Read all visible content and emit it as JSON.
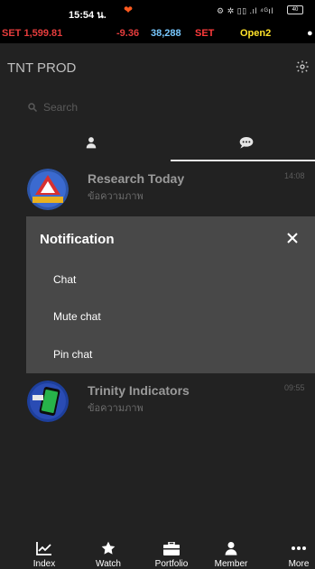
{
  "status": {
    "time": "15:54 น.",
    "battery": "40",
    "icons": "⚙ ✲ ▯▯ .ıl ⁴ᴳıl"
  },
  "ticker": {
    "index": "SET 1,599.81",
    "change": "-9.36",
    "volume": "38,288",
    "market": "SET",
    "status": "Open2",
    "tail": "●"
  },
  "header": {
    "title": "TNT PROD"
  },
  "search": {
    "placeholder": "Search",
    "value": ""
  },
  "chats": [
    {
      "name": "Research Today",
      "preview": "ข้อความภาพ",
      "time": "14:08"
    },
    {
      "name": "Trinity Indicators",
      "preview": "ข้อความภาพ",
      "time": "09:55"
    }
  ],
  "modal": {
    "title": "Notification",
    "options": [
      "Chat",
      "Mute chat",
      "Pin chat"
    ]
  },
  "nav": {
    "items": [
      {
        "label": "Index",
        "icon": "chart-icon"
      },
      {
        "label": "Watch",
        "icon": "star-icon"
      },
      {
        "label": "Portfolio",
        "icon": "briefcase-icon"
      },
      {
        "label": "Member",
        "icon": "person-icon"
      },
      {
        "label": "More",
        "icon": "more-icon"
      }
    ]
  },
  "colors": {
    "background": "#222222",
    "modal": "#484848",
    "ticker_red": "#e73d3d",
    "ticker_blue": "#78c8ff",
    "ticker_yellow": "#ffe22a"
  }
}
